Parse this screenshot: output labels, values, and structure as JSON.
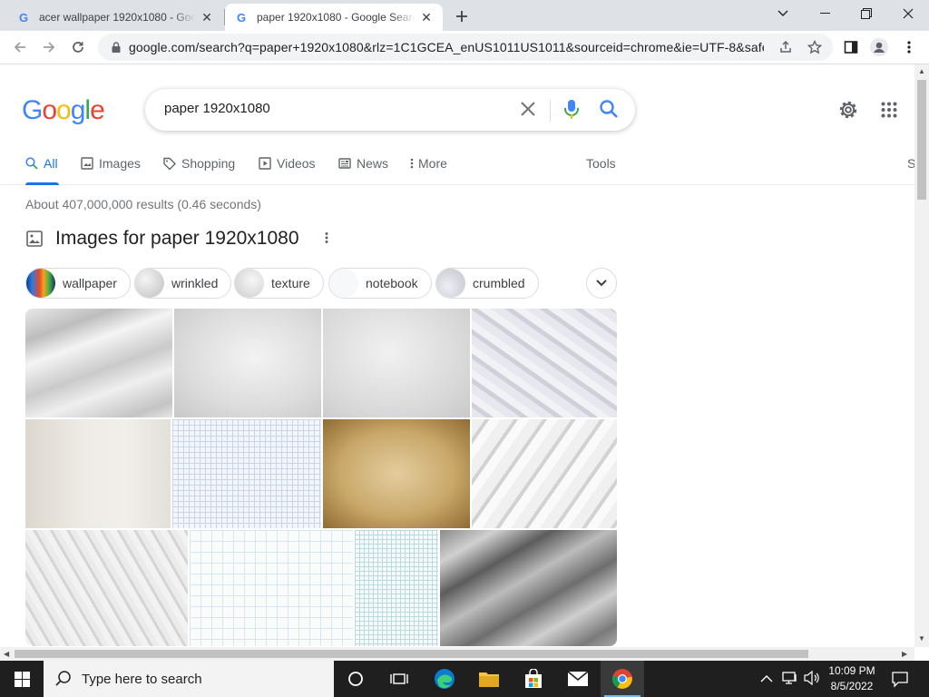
{
  "browser": {
    "tabs": [
      {
        "title": "acer wallpaper 1920x1080 - Goo",
        "active": false
      },
      {
        "title": "paper 1920x1080 - Google Searc",
        "active": true
      }
    ],
    "new_tab_icon": "plus-icon",
    "address": "google.com/search?q=paper+1920x1080&rlz=1C1GCEA_enUS1011US1011&sourceid=chrome&ie=UTF-8&safe..."
  },
  "search": {
    "query": "paper 1920x1080",
    "logo": "Google",
    "logo_colors": [
      "#4285f4",
      "#ea4335",
      "#fbbc05",
      "#4285f4",
      "#34a853",
      "#ea4335"
    ]
  },
  "nav": {
    "tabs": [
      {
        "label": "All",
        "icon": "search-icon",
        "active": true
      },
      {
        "label": "Images",
        "icon": "image-icon"
      },
      {
        "label": "Shopping",
        "icon": "tag-icon"
      },
      {
        "label": "Videos",
        "icon": "play-icon"
      },
      {
        "label": "News",
        "icon": "news-icon"
      },
      {
        "label": "More",
        "icon": "more-vert-icon"
      }
    ],
    "tools": "Tools",
    "cut_off": "S"
  },
  "results": {
    "stats": "About 407,000,000 results (0.46 seconds)",
    "images_title": "Images for paper 1920x1080",
    "chips": [
      "wallpaper",
      "wrinkled",
      "texture",
      "notebook",
      "crumbled"
    ]
  },
  "taskbar": {
    "search_placeholder": "Type here to search",
    "time": "10:09 PM",
    "date": "8/5/2022"
  },
  "colors": {
    "accent": "#1a73e8",
    "taskbar": "#1f1f1f"
  }
}
